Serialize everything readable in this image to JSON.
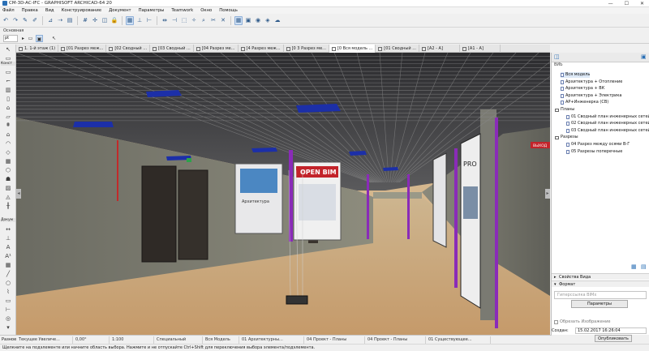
{
  "window": {
    "title": "CM-3D-AC-IFC - GRAPHISOFT ARCHICAD-64 20",
    "controls": [
      "—",
      "☐",
      "✕"
    ]
  },
  "menu": [
    "Файл",
    "Правка",
    "Вид",
    "Конструирование",
    "Документ",
    "Параметры",
    "Teamwork",
    "Окно",
    "Помощь"
  ],
  "infobar": {
    "label": "Основная",
    "field": "pt"
  },
  "toolbox": {
    "constr_label": "Конст",
    "doc_label": "Докум",
    "razn_label": "Разное"
  },
  "tabs": [
    {
      "label": "1. 1-й этаж (1)",
      "active": false
    },
    {
      "label": "[01 Разрез меж...",
      "active": false
    },
    {
      "label": "[02 Сводный ...",
      "active": false
    },
    {
      "label": "[03 Сводный ...",
      "active": false
    },
    {
      "label": "[04 Разрез ме...",
      "active": false
    },
    {
      "label": "[4 Разрез меж...",
      "active": false
    },
    {
      "label": "[0 3 Разрез ме...",
      "active": false
    },
    {
      "label": "[0 Вся модель ...",
      "active": true
    },
    {
      "label": "[01 Сводный ...",
      "active": false
    },
    {
      "label": "[A2 - A]",
      "active": false
    },
    {
      "label": "[A1 - A]",
      "active": false
    }
  ],
  "viewport": {
    "open_bim": "OPEN BIM",
    "poster_label": "Архитектура",
    "sign_label": "ВЫХОД",
    "wall_logo": "PRO",
    "colors": {
      "floor": "#d6b990",
      "ceiling": "#3a3a3c",
      "panel_blue": "#1c2fa8",
      "accent_purple": "#8a2bb8",
      "wall": "#8b8a7a"
    }
  },
  "navigator": {
    "view_label": "ВИЬ",
    "items": [
      {
        "label": "Вся модель",
        "type": "doc",
        "indent": 1,
        "selected": true
      },
      {
        "label": "Архитектура + Отопление",
        "type": "doc",
        "indent": 1
      },
      {
        "label": "Архитектура + ВК",
        "type": "doc",
        "indent": 1
      },
      {
        "label": "Архитектура + Электрика",
        "type": "doc",
        "indent": 1
      },
      {
        "label": "АР+Инженерка (СВ)",
        "type": "doc",
        "indent": 1
      },
      {
        "label": "Планы",
        "type": "folder",
        "indent": 0
      },
      {
        "label": "01 Сводный план инженерных сетей",
        "type": "doc",
        "indent": 2
      },
      {
        "label": "02 Сводный план инженерных сетей",
        "type": "doc",
        "indent": 2
      },
      {
        "label": "03 Сводный план инженерных сетей",
        "type": "doc",
        "indent": 2
      },
      {
        "label": "Разрезы",
        "type": "folder",
        "indent": 0
      },
      {
        "label": "04 Разрез между осями В-Г",
        "type": "doc",
        "indent": 2
      },
      {
        "label": "05 Разрезы поперечные",
        "type": "doc",
        "indent": 2
      }
    ],
    "sections": {
      "view_props": "Свойства Вида",
      "format": "Формат"
    },
    "format_placeholder": "Гиперссылка BIMx",
    "params_button": "Параметры",
    "crop_label": "Обрезать Изображение",
    "created_label": "Создан:",
    "created_value": "15.02.2017 16:26:04",
    "publish_button": "Опубликовать"
  },
  "status": {
    "fields": [
      "Текущее Увеличе...",
      "0,00°",
      "1:100",
      "Специальный",
      "Вся Модель",
      "01 Архитектурны...",
      "04 Проект - Планы",
      "04 Проект - Планы",
      "01 Существующее..."
    ],
    "hint": "Щелкните на подэлементе или начните область выбора. Нажмите и не отпускайте Ctrl+Shift для переключения выбора элемента/подэлемента."
  }
}
